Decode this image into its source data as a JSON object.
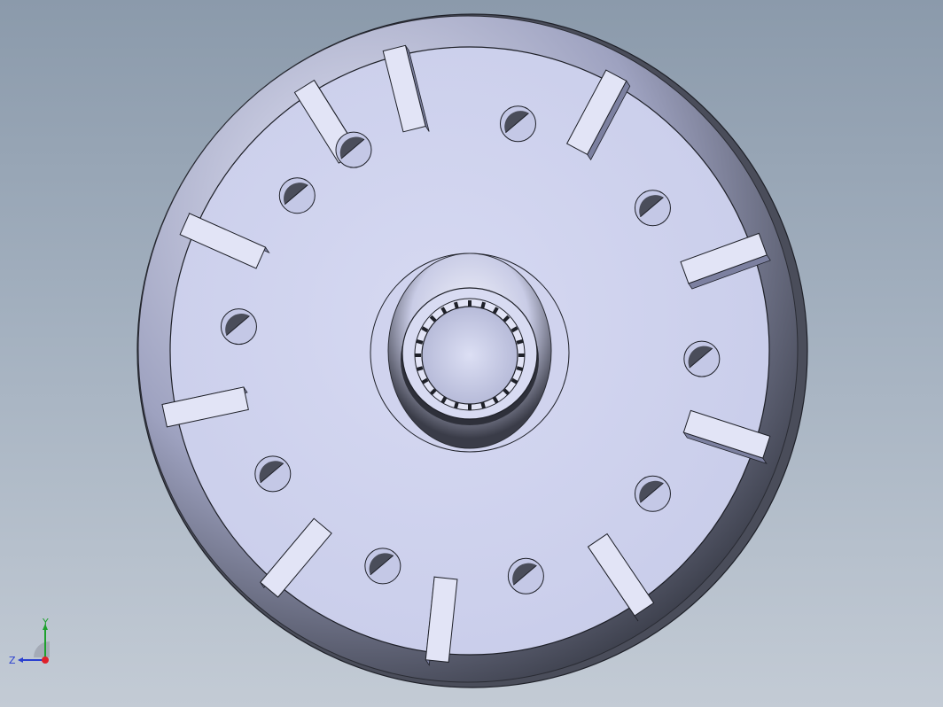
{
  "viewport": {
    "colors": {
      "background_top": "#8b9aab",
      "background_bottom": "#c3cbd5",
      "part_face": "#d2d5f0",
      "part_rim_dark": "#3c3f4c",
      "part_edge": "#1e2028",
      "rib_top": "#e2e4f6",
      "rib_side": "#7c80a0"
    },
    "model": {
      "description_icon": "impeller-part",
      "blade_count": 10,
      "hole_count": 10
    }
  },
  "triad": {
    "y_label": "Y",
    "z_label": "Z",
    "colors": {
      "x": "#e0202a",
      "y": "#1ea12e",
      "z": "#2a3fd0"
    }
  }
}
